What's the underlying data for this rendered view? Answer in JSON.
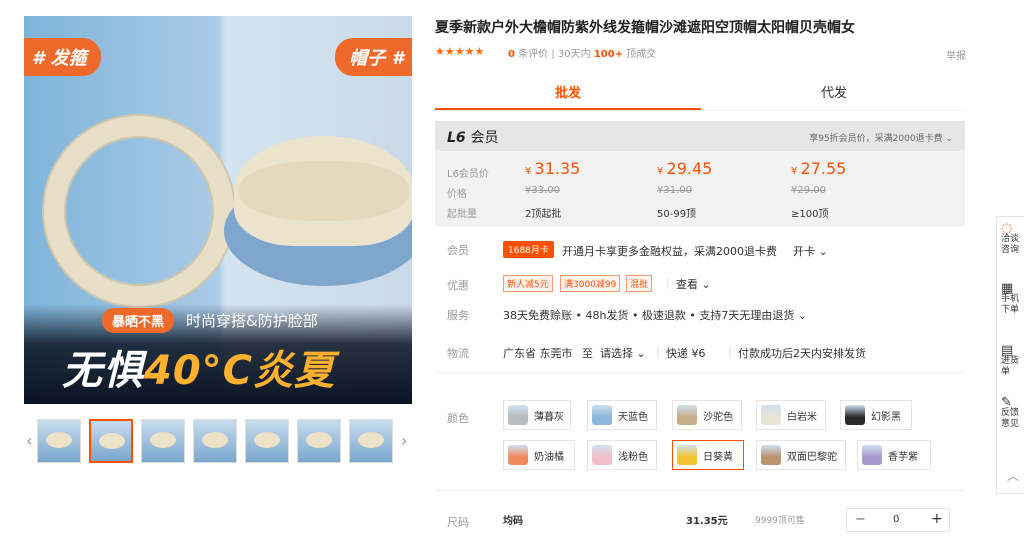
{
  "gallery": {
    "tag_left": "# 发箍",
    "tag_right": "帽子 #",
    "pill": "暴晒不黑",
    "subtitle": "时尚穿搭&防护脸部",
    "big_text_a": "无惧",
    "big_text_b": "40°C炎夏",
    "thumb_count": 7,
    "selected_thumb": 1
  },
  "product": {
    "title": "夏季新款户外大檐帽防紫外线发箍帽沙滩遮阳空顶帽太阳帽贝壳帽女",
    "stars": "★★★★★",
    "review_count": "0",
    "review_label": "条评价",
    "sep": "|",
    "sold_prefix": "30天内",
    "sold_count": "100+",
    "sold_unit": "顶成交",
    "report": "举报"
  },
  "tabs": {
    "wholesale": "批发",
    "dropship": "代发"
  },
  "member": {
    "level": "L6",
    "level_label": "会员",
    "note": "享95折会员价，采满2000退卡费 ⌄",
    "row_labels": [
      "L6会员价",
      "价格",
      "起批量"
    ],
    "tiers": [
      {
        "price": "31.35",
        "orig": "¥33.00",
        "batch": "2顶起批"
      },
      {
        "price": "29.45",
        "orig": "¥31.00",
        "batch": "50-99顶"
      },
      {
        "price": "27.55",
        "orig": "¥29.00",
        "batch": "≥100顶"
      }
    ],
    "currency": "¥"
  },
  "rows": {
    "member_label": "会员",
    "member_badge": "1688月卡",
    "member_text": "开通月卡享更多金融权益，采满2000退卡费",
    "member_action": "开卡 ⌄",
    "promo_label": "优惠",
    "coupons": [
      "新人减5元",
      "满3000减99",
      "混批"
    ],
    "promo_view": "查看 ⌄",
    "service_label": "服务",
    "service_text": "38天免费赊账 • 48h发货 • 极速退款 • 支持7天无理由退货 ⌄",
    "logistics_label": "物流",
    "logistics_from": "广东省 东莞市",
    "logistics_to": "至",
    "logistics_select": "请选择 ⌄",
    "logistics_express": "快递 ¥6",
    "logistics_note": "付款成功后2天内安排发货"
  },
  "colors": {
    "label": "颜色",
    "options": [
      {
        "name": "薄暮灰",
        "swatch": "#b9bcc2"
      },
      {
        "name": "天蓝色",
        "swatch": "#8fb6dc"
      },
      {
        "name": "沙驼色",
        "swatch": "#c9ad88"
      },
      {
        "name": "白岩米",
        "swatch": "#eae4d6"
      },
      {
        "name": "幻影黑",
        "swatch": "#2a2a2a"
      },
      {
        "name": "奶油橘",
        "swatch": "#f08a5d"
      },
      {
        "name": "浅粉色",
        "swatch": "#f2c0c8"
      },
      {
        "name": "日葵黄",
        "swatch": "#f3c230"
      },
      {
        "name": "双面巴黎驼",
        "swatch": "#b89470"
      },
      {
        "name": "香芋紫",
        "swatch": "#a99acb"
      }
    ],
    "selected": 7
  },
  "size": {
    "label": "尺码",
    "value": "均码",
    "price": "31.35元",
    "stock": "9999顶可售",
    "qty": "0",
    "minus": "−",
    "plus": "+"
  },
  "tools": [
    {
      "icon": "chat-icon",
      "glyph": "◌",
      "label": "洽谈咨询"
    },
    {
      "icon": "qr-icon",
      "glyph": "▦",
      "label": "手机下单"
    },
    {
      "icon": "list-icon",
      "glyph": "▤",
      "label": "进货单"
    },
    {
      "icon": "edit-icon",
      "glyph": "✎",
      "label": "反馈意见"
    }
  ],
  "tools_up": "︿",
  "accent_color": "#ff5000"
}
